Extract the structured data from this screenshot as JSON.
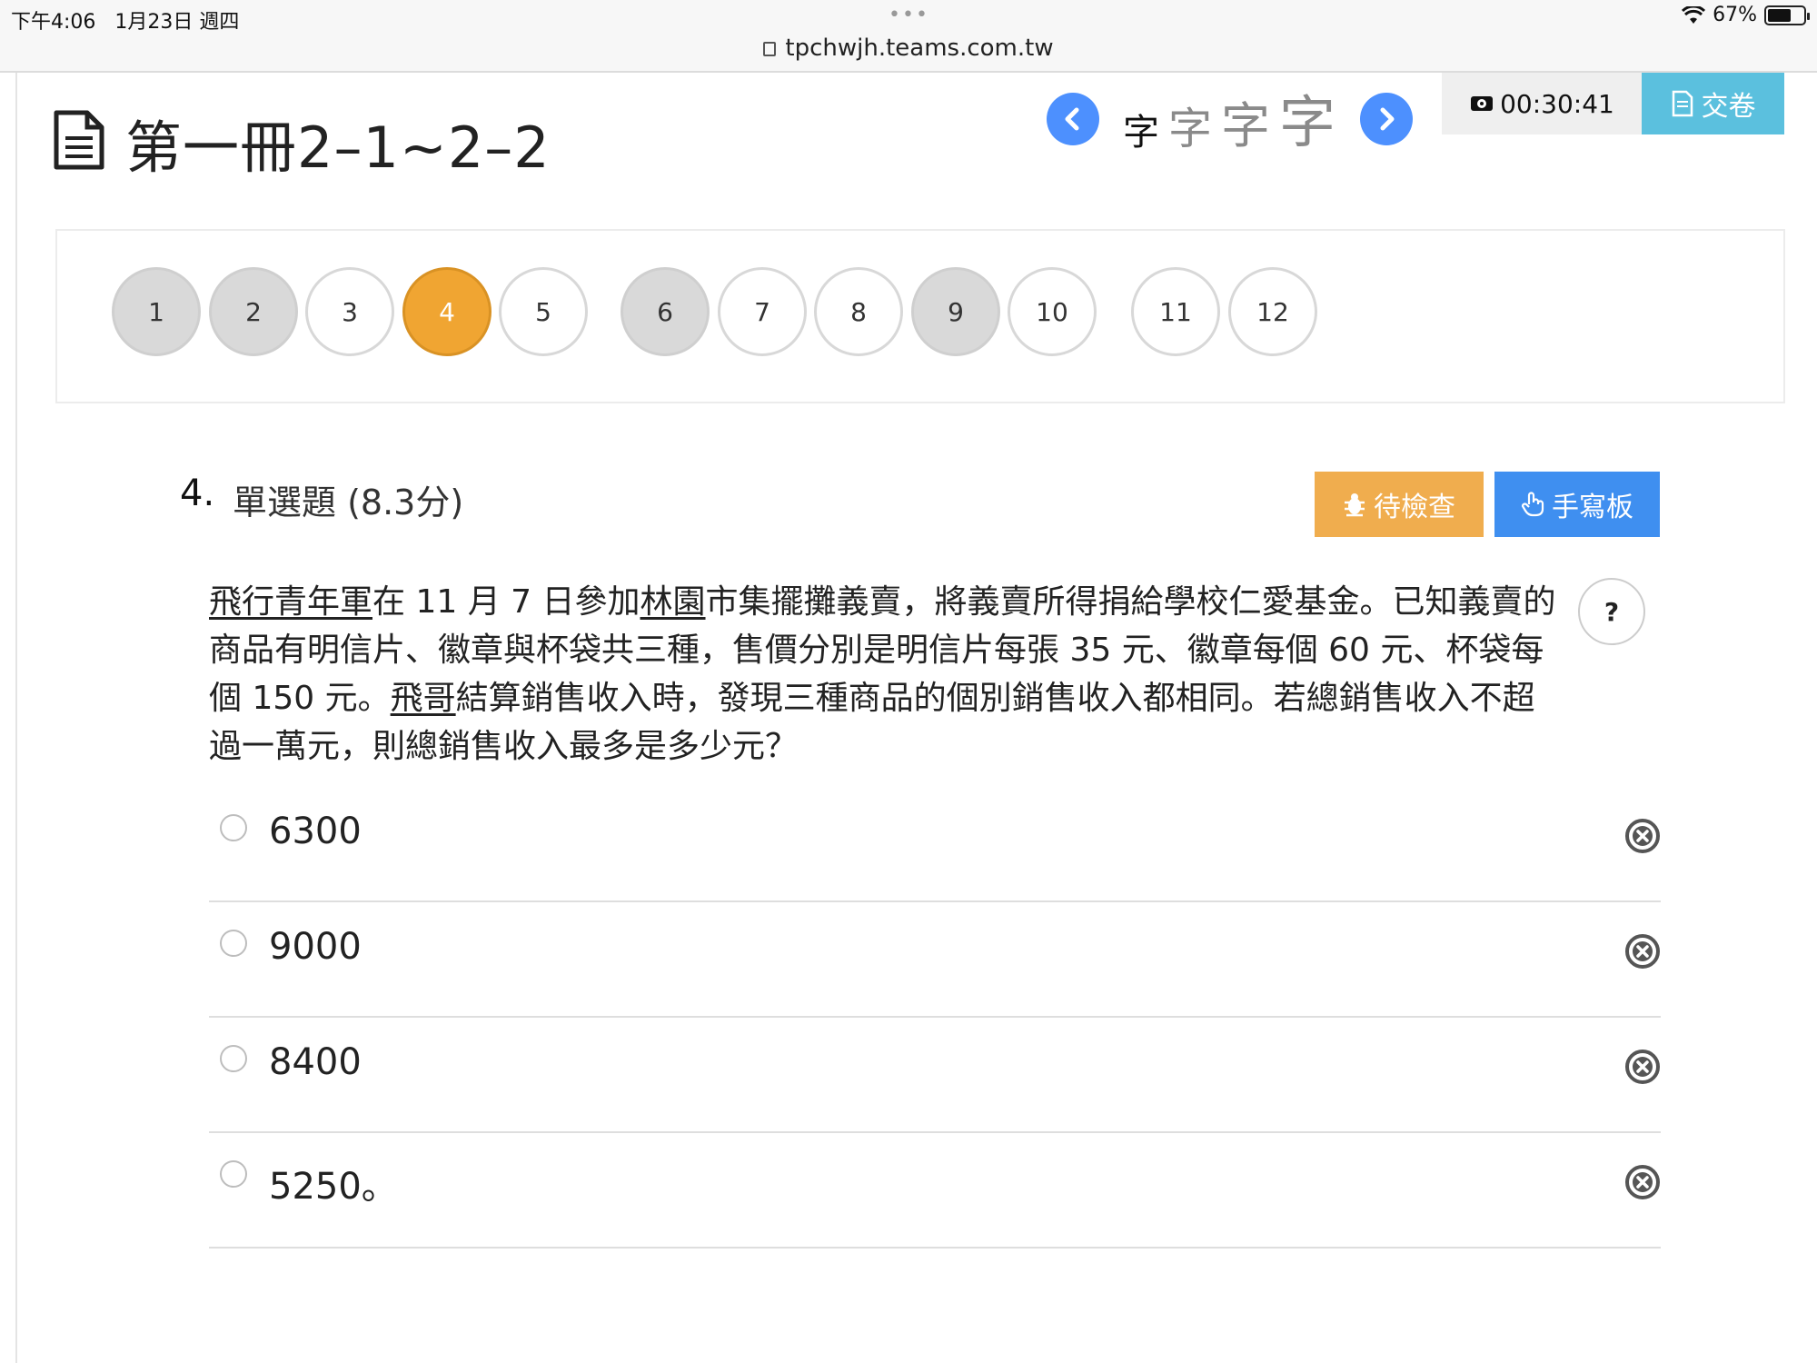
{
  "status_bar": {
    "time": "下午4:06   1月23日 週四",
    "dots": "•••",
    "url": "tpchwjh.teams.com.tw",
    "battery": "67%",
    "battery_level": 0.67
  },
  "header": {
    "title": "第一冊2–1~2–2",
    "font_size_glyph": "字",
    "timer": "00:30:41",
    "submit_label": "交卷"
  },
  "question_nav": [
    {
      "label": "1",
      "state": "answered"
    },
    {
      "label": "2",
      "state": "answered"
    },
    {
      "label": "3",
      "state": "unanswered"
    },
    {
      "label": "4",
      "state": "current"
    },
    {
      "label": "5",
      "state": "unanswered"
    },
    {
      "label": "6",
      "state": "answered"
    },
    {
      "label": "7",
      "state": "unanswered"
    },
    {
      "label": "8",
      "state": "unanswered"
    },
    {
      "label": "9",
      "state": "answered"
    },
    {
      "label": "10",
      "state": "unanswered"
    },
    {
      "label": "11",
      "state": "unanswered"
    },
    {
      "label": "12",
      "state": "unanswered"
    }
  ],
  "question": {
    "number": "4.",
    "type": "單選題 (8.3分)",
    "review_label": "待檢查",
    "handwriting_label": "手寫板",
    "help_label": "?",
    "text_parts": [
      {
        "t": "飛行青年軍",
        "u": true
      },
      {
        "t": "在 11 月 7 日參加",
        "u": false
      },
      {
        "t": "林園",
        "u": true
      },
      {
        "t": "市集擺攤義賣，將義賣所得捐給學校仁愛基金。已知義賣的商品有明信片、徽章與杯袋共三種，售價分別是明信片每張 35 元、徽章每個 60 元、杯袋每個 150 元。",
        "u": false
      },
      {
        "t": "飛哥",
        "u": true
      },
      {
        "t": "結算銷售收入時，發現三種商品的個別銷售收入都相同。若總銷售收入不超過一萬元，則總銷售收入最多是多少元？",
        "u": false
      }
    ],
    "options": [
      "6300",
      "9000",
      "8400",
      "5250。"
    ]
  },
  "colors": {
    "current": "#f0a532",
    "answered": "#d9d9d9",
    "submit": "#5bc0de",
    "review": "#f0ad4e",
    "handwriting": "#3f8ff0",
    "nav_arrow": "#4d90fe"
  }
}
